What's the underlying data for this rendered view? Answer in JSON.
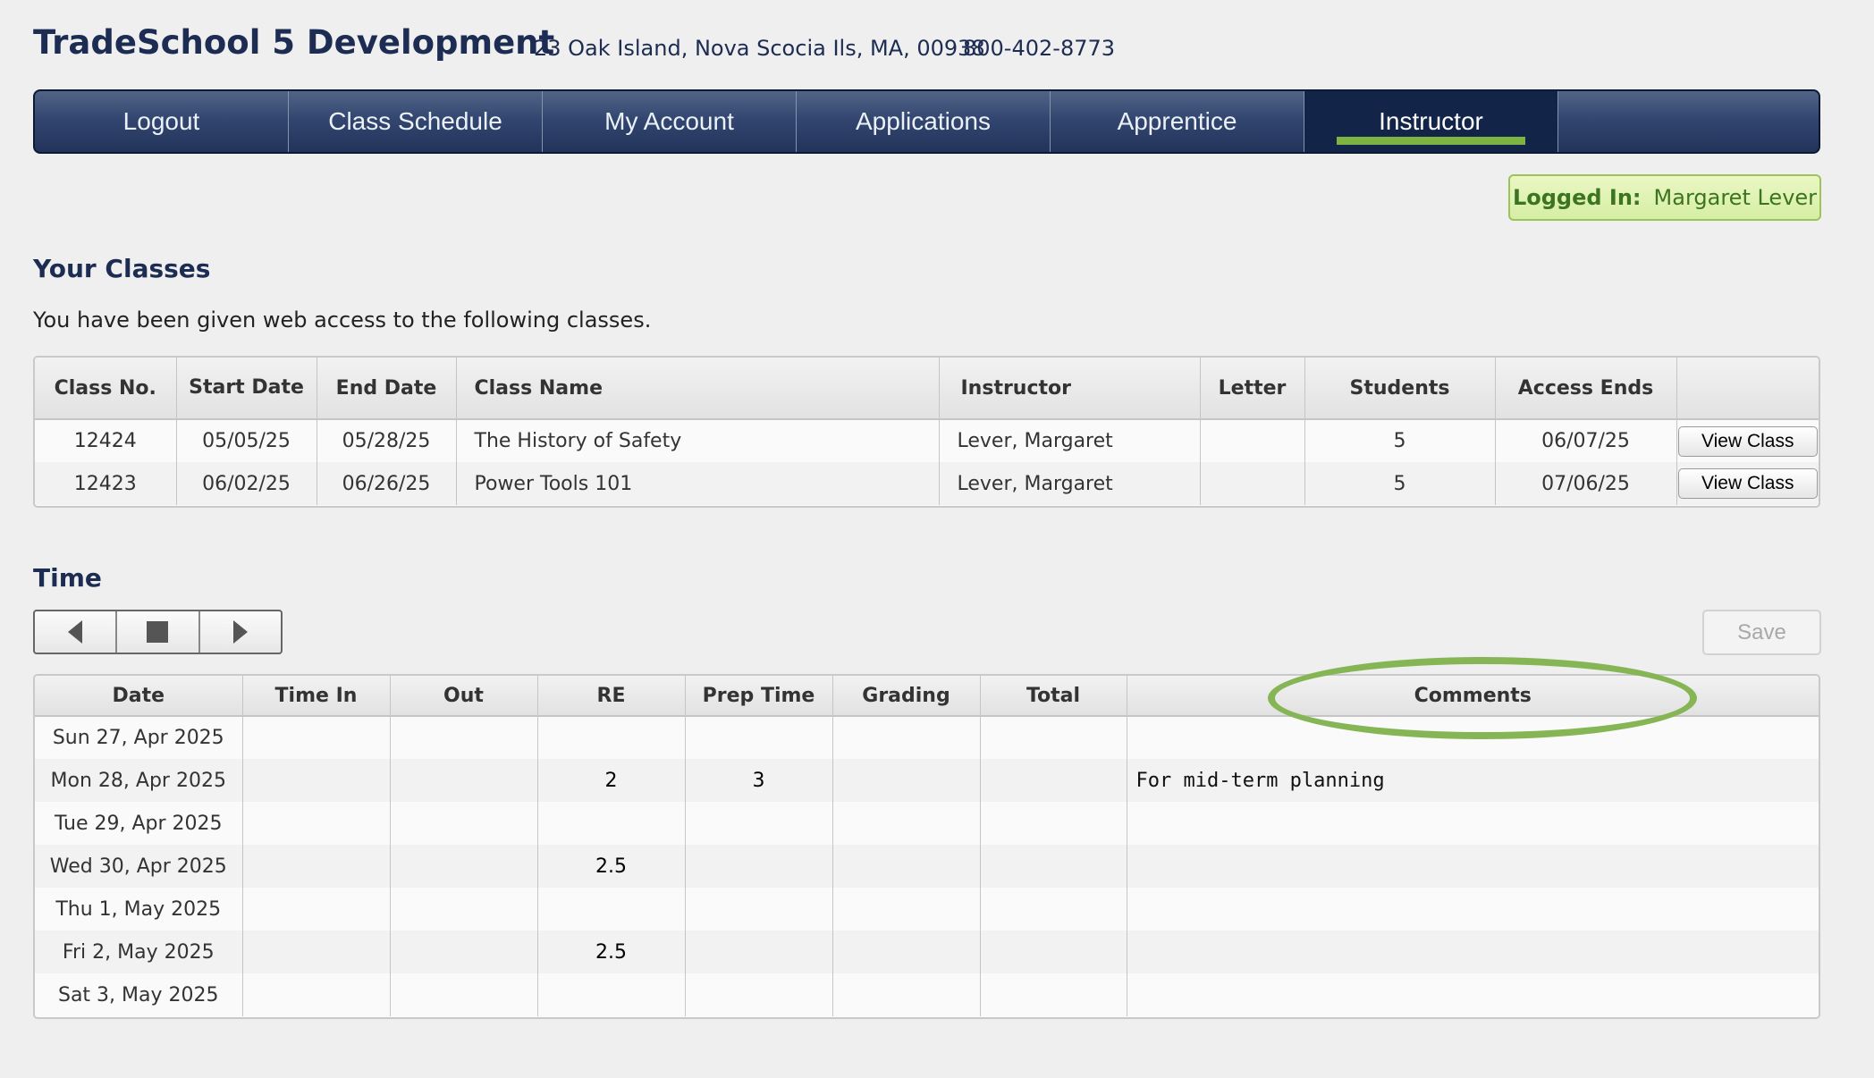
{
  "header": {
    "title": "TradeSchool 5 Development",
    "address": "23 Oak Island, Nova Scocia Ils, MA, 00938",
    "phone": "800-402-8773"
  },
  "nav": {
    "items": [
      {
        "label": "Logout"
      },
      {
        "label": "Class Schedule"
      },
      {
        "label": "My Account"
      },
      {
        "label": "Applications"
      },
      {
        "label": "Apprentice"
      },
      {
        "label": "Instructor",
        "active": true
      }
    ],
    "active_underline_color": "#7cb342"
  },
  "login": {
    "label": "Logged In:",
    "user": "Margaret Lever"
  },
  "classes": {
    "title": "Your Classes",
    "intro": "You have been given web access to the following classes.",
    "headers": [
      "Class No.",
      "Start Date",
      "End Date",
      "Class Name",
      "Instructor",
      "Letter",
      "Students",
      "Access Ends",
      ""
    ],
    "rows": [
      {
        "class_no": "12424",
        "start": "05/05/25",
        "end": "05/28/25",
        "name": "The History of Safety",
        "instructor": "Lever, Margaret",
        "letter": "",
        "students": "5",
        "access_ends": "06/07/25",
        "action": "View Class"
      },
      {
        "class_no": "12423",
        "start": "06/02/25",
        "end": "06/26/25",
        "name": "Power Tools 101",
        "instructor": "Lever, Margaret",
        "letter": "",
        "students": "5",
        "access_ends": "07/06/25",
        "action": "View Class"
      }
    ]
  },
  "time": {
    "title": "Time",
    "pager": {
      "prev_icon": "triangle-left-icon",
      "stop_icon": "square-stop-icon",
      "next_icon": "triangle-right-icon"
    },
    "save_label": "Save",
    "headers": [
      "Date",
      "Time In",
      "Out",
      "RE",
      "Prep Time",
      "Grading",
      "Total",
      "Comments"
    ],
    "rows": [
      {
        "date": "Sun 27, Apr 2025",
        "time_in": "",
        "out": "",
        "re": "",
        "prep": "",
        "grading": "",
        "total": "",
        "comments": ""
      },
      {
        "date": "Mon 28, Apr 2025",
        "time_in": "",
        "out": "",
        "re": "2",
        "prep": "3",
        "grading": "",
        "total": "",
        "comments": "For mid-term planning"
      },
      {
        "date": "Tue 29, Apr 2025",
        "time_in": "",
        "out": "",
        "re": "",
        "prep": "",
        "grading": "",
        "total": "",
        "comments": ""
      },
      {
        "date": "Wed 30, Apr 2025",
        "time_in": "",
        "out": "",
        "re": "2.5",
        "prep": "",
        "grading": "",
        "total": "",
        "comments": ""
      },
      {
        "date": "Thu 1, May 2025",
        "time_in": "",
        "out": "",
        "re": "",
        "prep": "",
        "grading": "",
        "total": "",
        "comments": ""
      },
      {
        "date": "Fri 2, May 2025",
        "time_in": "",
        "out": "",
        "re": "2.5",
        "prep": "",
        "grading": "",
        "total": "",
        "comments": ""
      },
      {
        "date": "Sat 3, May 2025",
        "time_in": "",
        "out": "",
        "re": "",
        "prep": "",
        "grading": "",
        "total": "",
        "comments": ""
      }
    ],
    "annotation_color": "#86b555"
  }
}
